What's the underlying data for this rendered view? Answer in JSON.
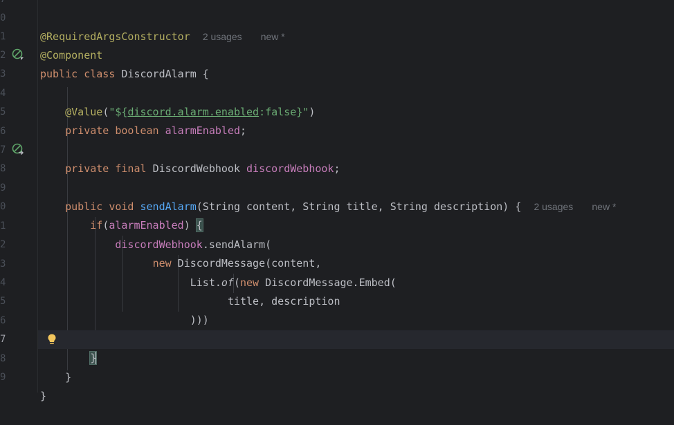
{
  "line_numbers": [
    "0",
    "1",
    "2",
    "3",
    "4",
    "5",
    "6",
    "7",
    "8",
    "9",
    "0",
    "1",
    "2",
    "3",
    "4",
    "5",
    "6",
    "7",
    "8",
    "9"
  ],
  "lines": {
    "l0": {
      "annotation": "@RequiredArgsConstructor",
      "usages": "2 usages",
      "new": "new *"
    },
    "l1": {
      "annotation": "@Component"
    },
    "l2": {
      "kw": "public class",
      "name": "DiscordAlarm",
      "rest": " {"
    },
    "l4": {
      "annotation": "@Value",
      "paren_open": "(",
      "str_open": "\"${",
      "str_key": "discord.alarm.enabled",
      "str_rest": ":false}\"",
      "paren_close": ")"
    },
    "l5": {
      "kw": "private boolean",
      "field": "alarmEnabled",
      "rest": ";"
    },
    "l7": {
      "kw": "private final",
      "type": "DiscordWebhook",
      "field": "discordWebhook",
      "rest": ";"
    },
    "l9": {
      "kw": "public void",
      "fn": "sendAlarm",
      "rest": "(String content, String title, String description) {",
      "usages": "2 usages",
      "new": "new *"
    },
    "l10": {
      "kw": "if",
      "paren": "(",
      "field": "alarmEnabled",
      "rest": ") ",
      "brace": "{"
    },
    "l11": {
      "field": "discordWebhook",
      "rest": ".sendAlarm("
    },
    "l12": {
      "kw": "new",
      "rest": " DiscordMessage(content,"
    },
    "l13": {
      "pre": "List.",
      "method": "of",
      "paren": "(",
      "kw": "new",
      "rest": " DiscordMessage.Embed("
    },
    "l14": {
      "rest": "title, description"
    },
    "l15": {
      "rest": ")))"
    },
    "l16": {
      "rest": ");"
    },
    "l17": {
      "brace": "}"
    },
    "l18": {
      "rest": "}"
    },
    "l19": {
      "rest": "}"
    }
  },
  "icons": {
    "bean_icon": "spring-bean-icon",
    "inject_icon": "spring-inject-icon",
    "bulb_icon": "lightbulb-icon"
  },
  "colors": {
    "background": "#1e1f22",
    "keyword": "#cf8e6d",
    "annotation": "#b3ae60",
    "field": "#c77dbb",
    "string": "#6aab73",
    "function": "#56a8f5"
  }
}
